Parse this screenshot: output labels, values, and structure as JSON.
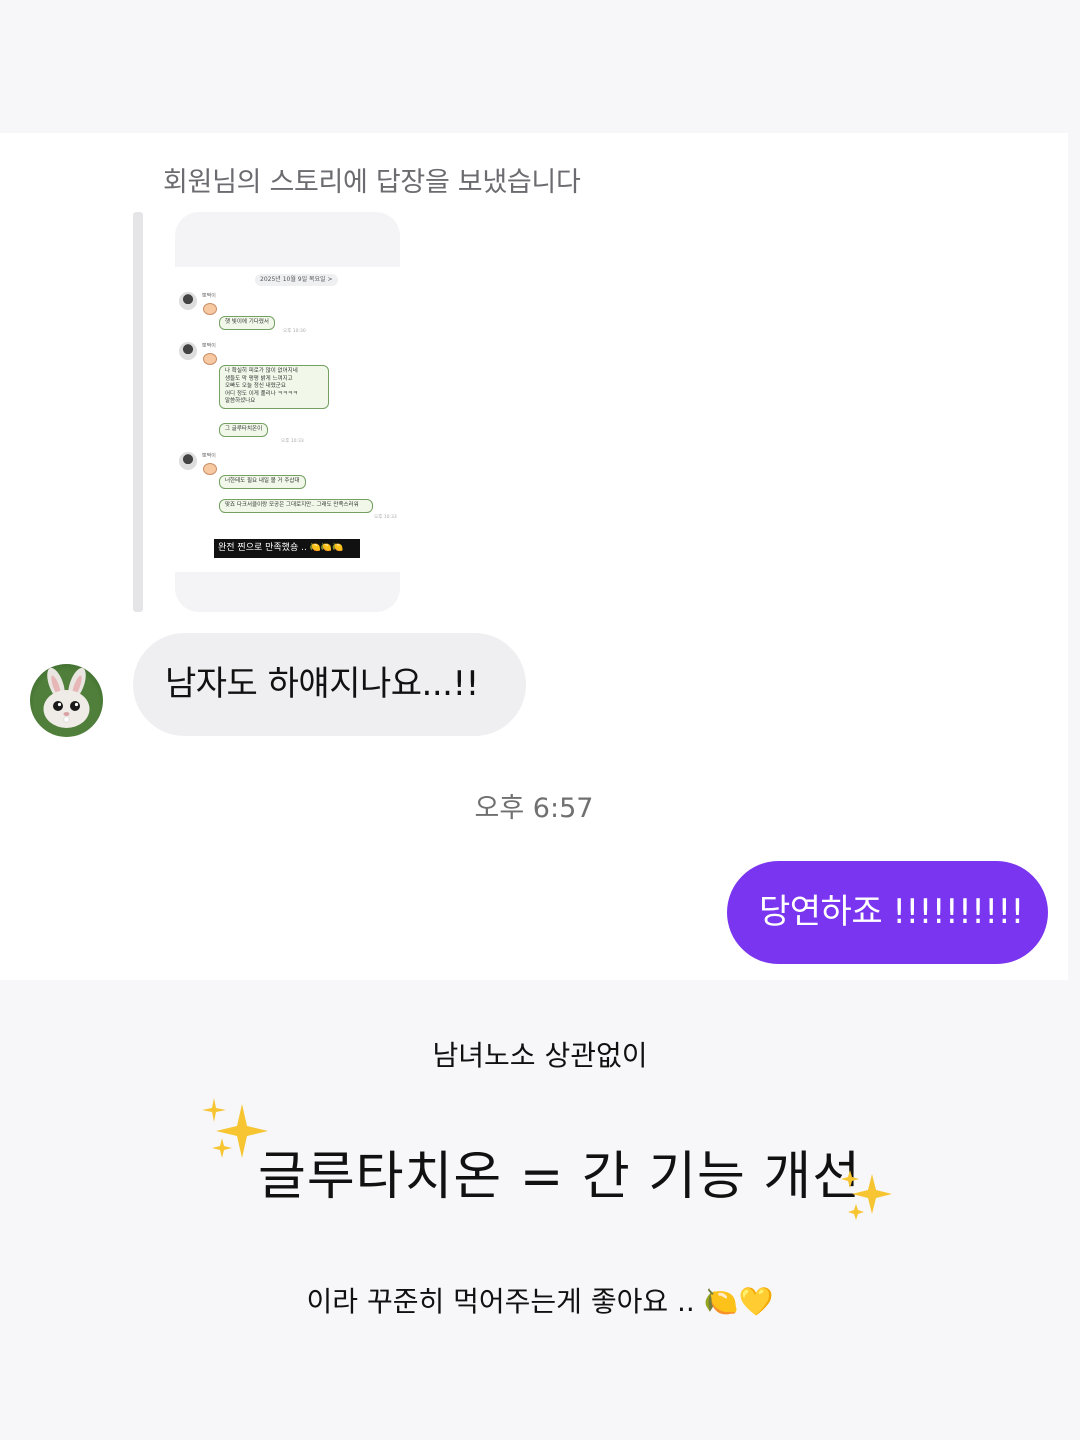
{
  "chat": {
    "reply_note": "회원님의 스토리에 답장을 보냈습니다",
    "story_preview": {
      "date_chip": "2025년 10월 9일 목요일 >",
      "sender_name": "뽀짝이",
      "messages": [
        "햇 빛이에 기다렸서",
        "나 확실히 피로가 많이 없어지네\n생들도 막 펑펑 밝게 느껴지고\n오빠도 오늘 정신 내렸군요\n어디 정도 이게 풀리나 ㅋㅋㅋㅋ\n말씀하셨나요",
        "그 글루타치온이",
        "너한테도 필요 내일 볼 거 주삽대",
        "맞죠 다크서클이랑 모공은 그대로지만.. 그래도 만족스러워"
      ],
      "times": [
        "오후 10:30",
        "오후 10:33",
        "오후 10:33"
      ],
      "caption": "완전 찐으로 만족했숑 .. 🍋🍋🍋"
    },
    "received_message": "남자도 하얘지나요...!!",
    "timestamp": "오후 6:57",
    "sent_message": "당연하죠 !!!!!!!!!!"
  },
  "caption": {
    "line1": "남녀노소 상관없이",
    "headline": "글루타치온 = 간 기능 개선",
    "line3": "이라 꾸준히 먹어주는게 좋아요 .. 🍋💛"
  },
  "colors": {
    "sent_bubble": "#7a35f0",
    "received_bubble": "#efeff2",
    "sparkle": "#f6c531"
  },
  "icons": {
    "avatar": "rabbit-avatar",
    "sparkle": "sparkles-icon"
  }
}
